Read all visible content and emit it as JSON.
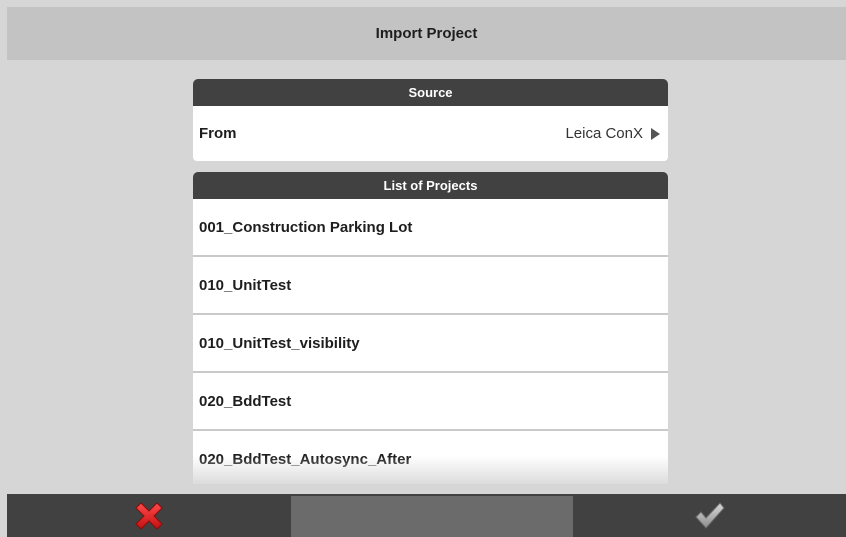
{
  "header": {
    "title": "Import Project"
  },
  "source": {
    "header": "Source",
    "from_label": "From",
    "from_value": "Leica ConX",
    "chevron_icon": "chevron-right-icon"
  },
  "projects": {
    "header": "List of Projects",
    "items": [
      "001_Construction Parking Lot",
      "010_UnitTest",
      "010_UnitTest_visibility",
      "020_BddTest",
      "020_BddTest_Autosync_After"
    ]
  },
  "footer": {
    "cancel_icon": "close-icon",
    "confirm_icon": "checkmark-icon"
  },
  "colors": {
    "background": "#d6d6d6",
    "titlebar": "#c3c3c3",
    "section_header": "#414141",
    "footer": "#414141",
    "cancel_red": "#e02424",
    "confirm_gray": "#9a9a9a"
  }
}
